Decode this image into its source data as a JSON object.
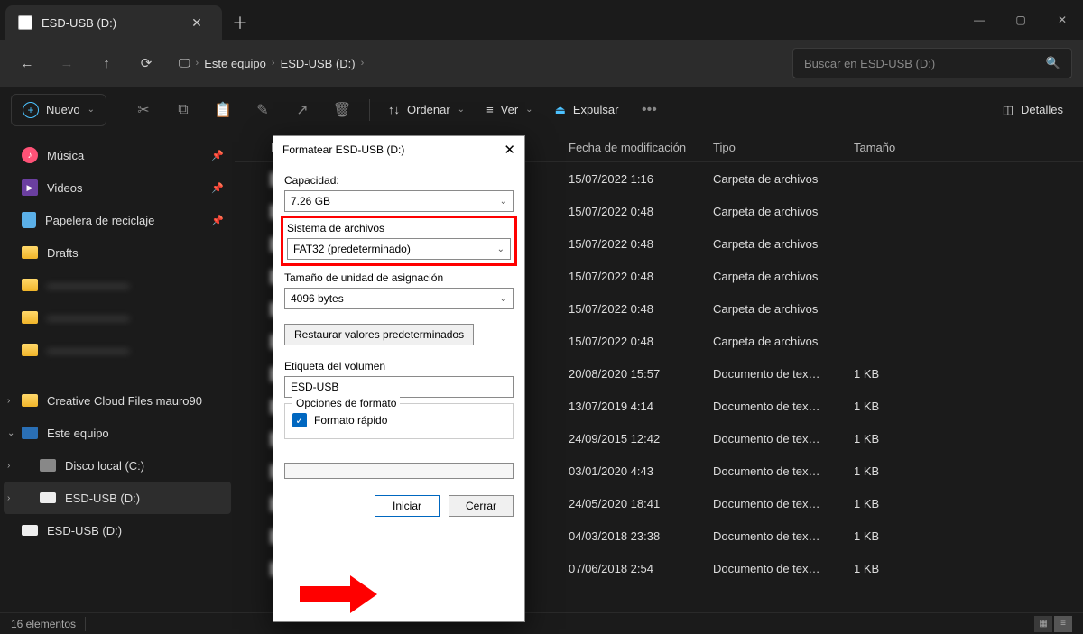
{
  "window": {
    "title": "ESD-USB (D:)"
  },
  "nav": {
    "breadcrumb": [
      "Este equipo",
      "ESD-USB (D:)"
    ],
    "search_placeholder": "Buscar en ESD-USB (D:)"
  },
  "toolbar": {
    "new": "Nuevo",
    "sort": "Ordenar",
    "view": "Ver",
    "eject": "Expulsar",
    "details": "Detalles"
  },
  "sidebar": {
    "items": [
      {
        "label": "Música",
        "pin": true,
        "icon": "music"
      },
      {
        "label": "Videos",
        "pin": true,
        "icon": "video"
      },
      {
        "label": "Papelera de reciclaje",
        "pin": true,
        "icon": "trash"
      },
      {
        "label": "Drafts",
        "pin": false,
        "icon": "folder"
      },
      {
        "label": "———————",
        "pin": false,
        "icon": "folder",
        "blur": true
      },
      {
        "label": "———————",
        "pin": false,
        "icon": "folder",
        "blur": true
      },
      {
        "label": "———————",
        "pin": false,
        "icon": "folder",
        "blur": true
      }
    ],
    "tree": [
      {
        "label": "Creative Cloud Files   mauro90",
        "exp": ">",
        "icon": "folder"
      },
      {
        "label": "Este equipo",
        "exp": "v",
        "icon": "pc"
      },
      {
        "label": "Disco local (C:)",
        "exp": ">",
        "icon": "hdd",
        "indent": 1
      },
      {
        "label": "ESD-USB (D:)",
        "exp": ">",
        "icon": "usb",
        "indent": 1,
        "sel": true
      },
      {
        "label": "ESD-USB (D:)",
        "exp": "",
        "icon": "usb"
      }
    ]
  },
  "filelist": {
    "headers": {
      "name": "Nombre",
      "date": "Fecha de modificación",
      "type": "Tipo",
      "size": "Tamaño"
    },
    "rows": [
      {
        "name": "",
        "date": "15/07/2022 1:16",
        "type": "Carpeta de archivos",
        "size": ""
      },
      {
        "name": "",
        "date": "15/07/2022 0:48",
        "type": "Carpeta de archivos",
        "size": ""
      },
      {
        "name": "",
        "date": "15/07/2022 0:48",
        "type": "Carpeta de archivos",
        "size": ""
      },
      {
        "name": "",
        "date": "15/07/2022 0:48",
        "type": "Carpeta de archivos",
        "size": ""
      },
      {
        "name": "",
        "date": "15/07/2022 0:48",
        "type": "Carpeta de archivos",
        "size": ""
      },
      {
        "name": "",
        "date": "15/07/2022 0:48",
        "type": "Carpeta de archivos",
        "size": ""
      },
      {
        "name": "",
        "date": "20/08/2020 15:57",
        "type": "Documento de tex…",
        "size": "1 KB"
      },
      {
        "name": "",
        "date": "13/07/2019 4:14",
        "type": "Documento de tex…",
        "size": "1 KB"
      },
      {
        "name": "",
        "date": "24/09/2015 12:42",
        "type": "Documento de tex…",
        "size": "1 KB"
      },
      {
        "name": "",
        "date": "03/01/2020 4:43",
        "type": "Documento de tex…",
        "size": "1 KB"
      },
      {
        "name": "",
        "date": "24/05/2020 18:41",
        "type": "Documento de tex…",
        "size": "1 KB"
      },
      {
        "name": "",
        "date": "04/03/2018 23:38",
        "type": "Documento de tex…",
        "size": "1 KB"
      },
      {
        "name": "",
        "date": "07/06/2018 2:54",
        "type": "Documento de tex…",
        "size": "1 KB"
      }
    ]
  },
  "status": {
    "count": "16 elementos"
  },
  "dialog": {
    "title": "Formatear ESD-USB (D:)",
    "capacity_label": "Capacidad:",
    "capacity_value": "7.26 GB",
    "fs_label": "Sistema de archivos",
    "fs_value": "FAT32 (predeterminado)",
    "alloc_label": "Tamaño de unidad de asignación",
    "alloc_value": "4096 bytes",
    "restore": "Restaurar valores predeterminados",
    "vol_label": "Etiqueta del volumen",
    "vol_value": "ESD-USB",
    "fmt_group": "Opciones de formato",
    "quick": "Formato rápido",
    "start": "Iniciar",
    "close": "Cerrar"
  }
}
